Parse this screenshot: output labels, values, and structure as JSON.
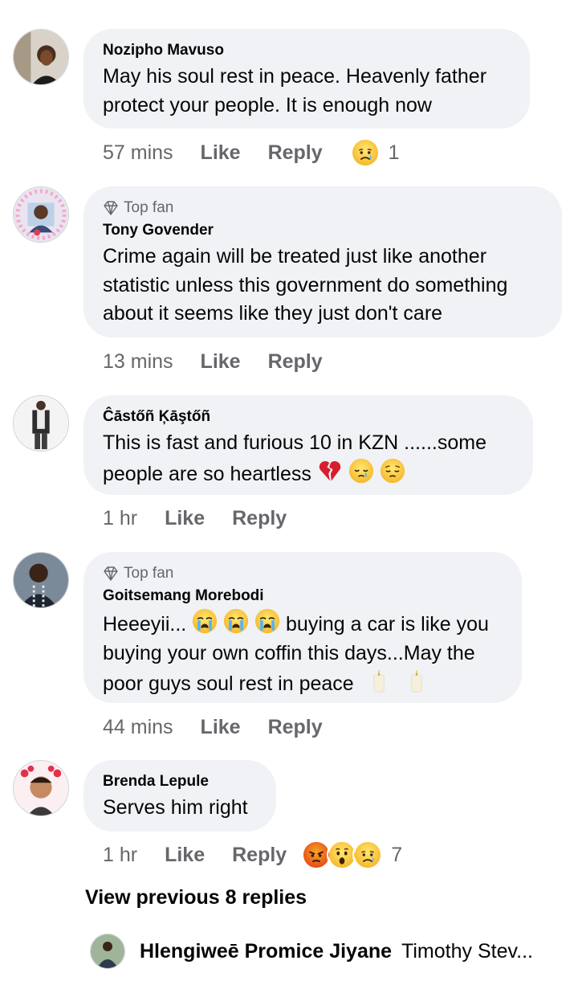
{
  "comments": [
    {
      "name": "Nozipho Mavuso",
      "top_fan": false,
      "lines": [
        "May his soul rest in peace. Heavenly father",
        "protect your people. It is enough now"
      ],
      "time": "57 mins",
      "like": "Like",
      "reply": "Reply",
      "reactions": [
        "sad-face"
      ],
      "reaction_count": "1"
    },
    {
      "name": "Tony Govender",
      "top_fan": true,
      "top_fan_label": "Top fan",
      "lines": [
        "Crime again will be treated just like another",
        "statistic unless this government do something",
        "about it seems like they just don't care"
      ],
      "time": "13 mins",
      "like": "Like",
      "reply": "Reply"
    },
    {
      "name": "Ĉāstőñ Ķāştőñ",
      "top_fan": false,
      "line1": "This is fast and furious 10 in KZN ......some",
      "line2": "people are so heartless",
      "time": "1 hr",
      "like": "Like",
      "reply": "Reply"
    },
    {
      "name": "Goitsemang Morebodi",
      "top_fan": true,
      "top_fan_label": "Top fan",
      "line1_a": "Heeeyii...",
      "line1_b": " buying a car is like you",
      "line2": "buying your own coffin this days...May the",
      "line3": "poor guys soul rest in peace",
      "time": "44 mins",
      "like": "Like",
      "reply": "Reply"
    },
    {
      "name": "Brenda Lepule",
      "top_fan": false,
      "lines": [
        "Serves him right"
      ],
      "time": "1 hr",
      "like": "Like",
      "reply": "Reply",
      "reactions": [
        "angry-face",
        "wow-face",
        "sad-face"
      ],
      "reaction_count": "7"
    }
  ],
  "view_previous": "View previous 8 replies",
  "reply_preview": {
    "name": "Hlengiweē Promice Jiyane",
    "text": "Timothy Stev..."
  },
  "colors": {
    "bubble": "#f0f2f5",
    "secondary_text": "#65676b",
    "primary_text": "#050505"
  }
}
